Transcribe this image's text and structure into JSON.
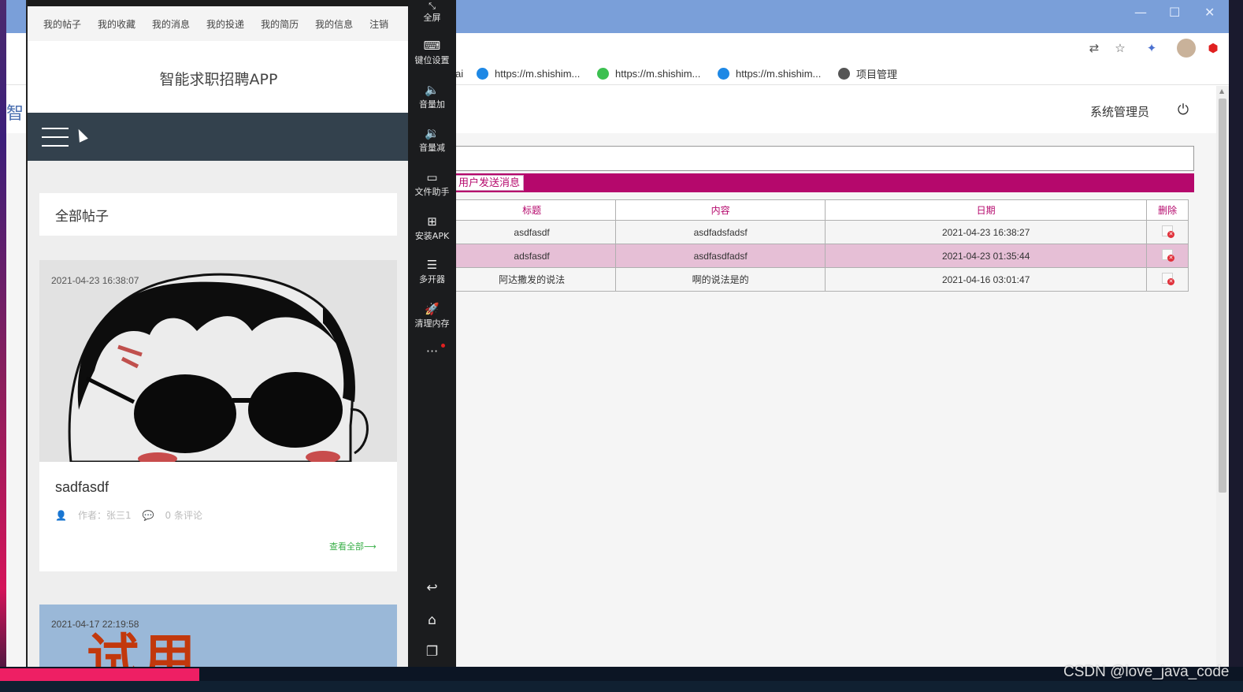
{
  "browser": {
    "bookmarks": [
      {
        "label": "ai",
        "color": "#ffffff"
      },
      {
        "label": "https://m.shishim...",
        "color": "#1e88e5"
      },
      {
        "label": "https://m.shishim...",
        "color": "#3cc050"
      },
      {
        "label": "https://m.shishim...",
        "color": "#1e88e5"
      },
      {
        "label": "项目管理",
        "color": "#555555"
      }
    ],
    "left_sliver_char": "智"
  },
  "admin_page": {
    "user_label": "系统管理员",
    "send_button": "用户发送消息",
    "table": {
      "headers": [
        "标题",
        "内容",
        "日期",
        "删除"
      ],
      "rows": [
        {
          "title": "asdfasdf",
          "content": "asdfadsfadsf",
          "date": "2021-04-23 16:38:27"
        },
        {
          "title": "adsfasdf",
          "content": "asdfasdfadsf",
          "date": "2021-04-23 01:35:44"
        },
        {
          "title": "阿达撒发的说法",
          "content": "啊的说法是的",
          "date": "2021-04-16 03:01:47"
        }
      ]
    },
    "colors": {
      "accent": "#b5086c",
      "alt_row": "#e6bfd6"
    }
  },
  "emulator": {
    "nav": [
      "我的帖子",
      "我的收藏",
      "我的消息",
      "我的投递",
      "我的简历",
      "我的信息",
      "注销"
    ],
    "app_title": "智能求职招聘APP",
    "section_title": "全部帖子",
    "posts": [
      {
        "date": "2021-04-23 16:38:07",
        "title": "sadfasdf",
        "author": "作者：张三1",
        "comments": "0 条评论",
        "more": "查看全部⟶"
      },
      {
        "date": "2021-04-17 22:19:58",
        "art_text": "试用"
      }
    ],
    "side": [
      {
        "label": "全屏",
        "icon": "fullscreen-icon"
      },
      {
        "label": "键位设置",
        "icon": "keyboard-icon"
      },
      {
        "label": "音量加",
        "icon": "volume-up-icon"
      },
      {
        "label": "音量减",
        "icon": "volume-down-icon"
      },
      {
        "label": "文件助手",
        "icon": "file-assistant-icon"
      },
      {
        "label": "安装APK",
        "icon": "install-apk-icon"
      },
      {
        "label": "多开器",
        "icon": "multi-instance-icon"
      },
      {
        "label": "清理内存",
        "icon": "rocket-icon"
      }
    ],
    "more_dots": "···"
  },
  "watermark": "CSDN @love_java_code"
}
